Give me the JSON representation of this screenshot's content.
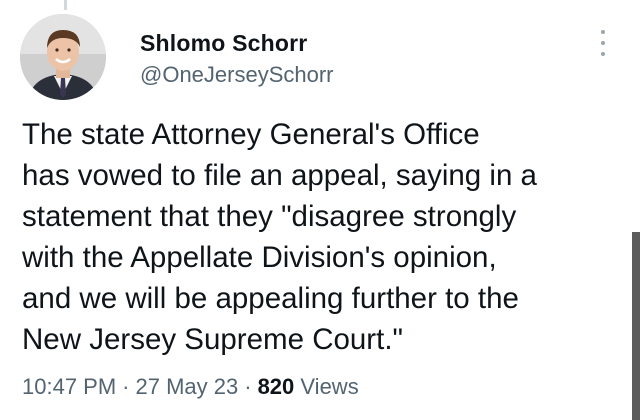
{
  "author": {
    "display_name": "Shlomo Schorr",
    "handle": "@OneJerseySchorr"
  },
  "tweet": {
    "text_lines": [
      "The state Attorney General's Office",
      "has vowed to file an appeal, saying in a",
      "statement that they \"disagree strongly",
      "with the Appellate Division's opinion,",
      "and we will be appealing further to the",
      "New Jersey Supreme Court.\""
    ],
    "time": "10:47 PM",
    "date": "27 May 23",
    "separator": "·",
    "views_count": "820",
    "views_label": "Views"
  },
  "icons": {
    "more": "more-vertical-icon"
  },
  "colors": {
    "text_primary": "#0f1419",
    "text_secondary": "#536471",
    "background": "#ffffff"
  }
}
